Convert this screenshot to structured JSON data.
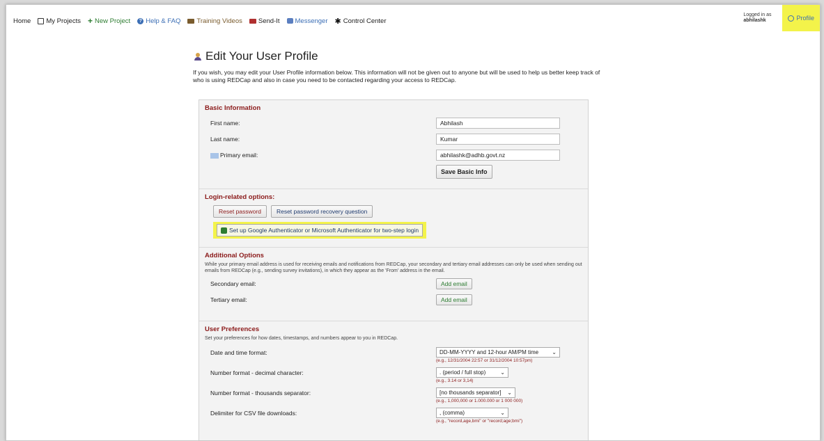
{
  "nav": {
    "home": "Home",
    "my_projects": "My Projects",
    "new_project": "New Project",
    "help": "Help & FAQ",
    "training": "Training Videos",
    "sendit": "Send-It",
    "messenger": "Messenger",
    "control_center": "Control Center",
    "logged_in_as": "Logged in as",
    "username": "abhilashk",
    "profile": "Profile"
  },
  "page": {
    "title": "Edit Your User Profile",
    "intro": "If you wish, you may edit your User Profile information below. This information will not be given out to anyone but will be used to help us better keep track of who is using REDCap and also in case you need to be contacted regarding your access to REDCap."
  },
  "basic": {
    "title": "Basic Information",
    "first_label": "First name:",
    "first_value": "Abhilash",
    "last_label": "Last name:",
    "last_value": "Kumar",
    "email_label": "Primary email:",
    "email_value": "abhilashk@adhb.govt.nz",
    "save_label": "Save Basic Info"
  },
  "login": {
    "title": "Login-related options:",
    "reset_password": "Reset password",
    "reset_question": "Reset password recovery question",
    "two_step": "Set up Google Authenticator or Microsoft Authenticator for two-step login"
  },
  "additional": {
    "title": "Additional Options",
    "desc": "While your primary email address is used for receiving emails and notifications from REDCap, your secondary and tertiary email addresses can only be used when sending out emails from REDCap (e.g., sending survey invitations), in which they appear as the 'From' address in the email.",
    "secondary_label": "Secondary email:",
    "tertiary_label": "Tertiary email:",
    "add_email": "Add email"
  },
  "prefs": {
    "title": "User Preferences",
    "desc": "Set your preferences for how dates, timestamps, and numbers appear to you in REDCap.",
    "date_label": "Date and time format:",
    "date_value": "DD-MM-YYYY and 12-hour AM/PM time",
    "date_hint": "(e.g., 12/31/2004 22:57 or 31/12/2004 10:57pm)",
    "decimal_label": "Number format - decimal character:",
    "decimal_value": ". (period / full stop)",
    "decimal_hint": "(e.g., 3.14 or 3,14)",
    "thousands_label": "Number format - thousands separator:",
    "thousands_value": "[no thousands separator]",
    "thousands_hint": "(e.g., 1,000,000 or 1.000.000 or 1 000 000)",
    "csv_label": "Delimiter for CSV file downloads:",
    "csv_value": ", (comma)",
    "csv_hint": "(e.g., \"record,age,bmi\" or \"record;age;bmi\")"
  },
  "colors": {
    "highlight": "#f3f34a",
    "section_title": "#8b1a1a",
    "link_blue": "#3b6eb5",
    "green": "#2e7d32"
  }
}
